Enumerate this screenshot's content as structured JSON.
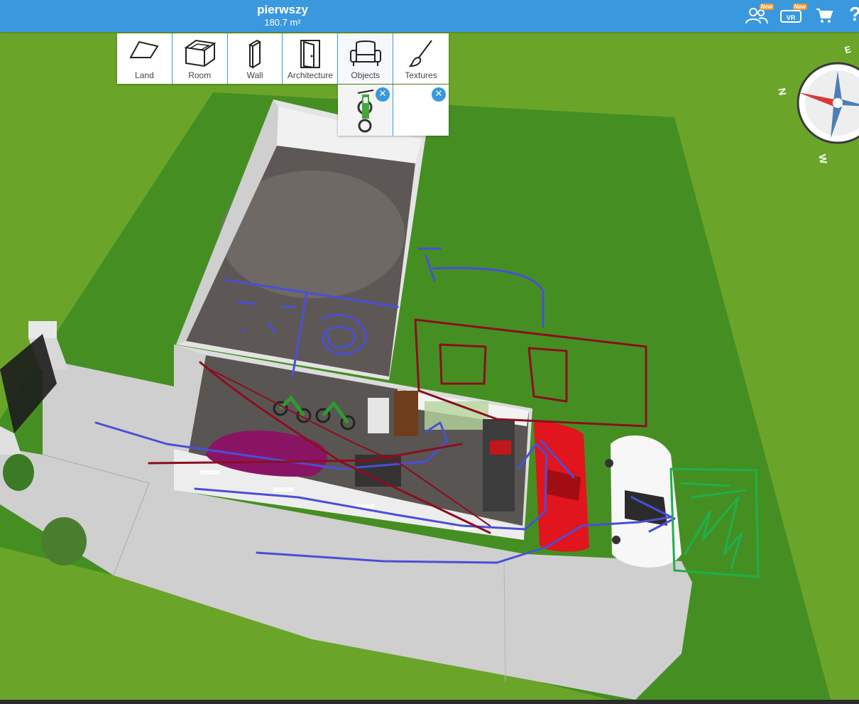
{
  "header": {
    "project_name": "pierwszy",
    "project_area": "180.7 m²",
    "badge_new": "New",
    "vr_label": "VR",
    "help_label": "?"
  },
  "toolbar": {
    "tools": [
      {
        "label": "Land",
        "icon": "land-icon"
      },
      {
        "label": "Room",
        "icon": "room-icon"
      },
      {
        "label": "Wall",
        "icon": "wall-icon"
      },
      {
        "label": "Architecture",
        "icon": "door-icon"
      },
      {
        "label": "Objects",
        "icon": "armchair-icon"
      },
      {
        "label": "Textures",
        "icon": "paintbrush-icon"
      }
    ]
  },
  "selection_tray": {
    "slots": [
      {
        "icon": "motorbike-thumbnail",
        "close": "✕"
      },
      {
        "icon": "empty-slot",
        "close": "✕"
      }
    ]
  },
  "compass": {
    "n": "N",
    "e": "E",
    "w": "W"
  },
  "colors": {
    "accent": "#3a98de",
    "grass": "#6aa52a",
    "lot": "#3f8e1f",
    "pavement": "#cfcfcf",
    "sketch_blue": "#4a4fd6",
    "sketch_red": "#8b0f1e",
    "sketch_green": "#1fb04a"
  }
}
